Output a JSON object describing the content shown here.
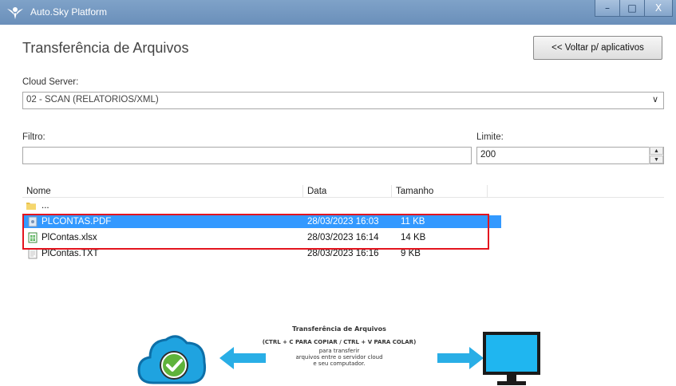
{
  "window": {
    "title": "Auto.Sky Platform",
    "minimize": "–",
    "maximize": "□",
    "close": "X"
  },
  "header": {
    "title": "Transferência de Arquivos",
    "back_button": "<< Voltar p/ aplicativos"
  },
  "cloud_server": {
    "label": "Cloud Server:",
    "selected": "02 - SCAN (RELATORIOS/XML)"
  },
  "filter": {
    "label": "Filtro:",
    "value": ""
  },
  "limit": {
    "label": "Limite:",
    "value": "200"
  },
  "file_list": {
    "columns": [
      "Nome",
      "Data",
      "Tamanho"
    ],
    "parent_dir": "...",
    "rows": [
      {
        "name": "PLCONTAS.PDF",
        "date": "28/03/2023 16:03",
        "size": "11 KB",
        "icon": "pdf-file-icon",
        "selected": true
      },
      {
        "name": "PlContas.xlsx",
        "date": "28/03/2023 16:14",
        "size": "14 KB",
        "icon": "excel-file-icon",
        "selected": false
      },
      {
        "name": "PlContas.TXT",
        "date": "28/03/2023 16:16",
        "size": "9 KB",
        "icon": "text-file-icon",
        "selected": false
      }
    ]
  },
  "banner": {
    "title": "Transferência de Arquivos",
    "shortcut": "(CTRL + C PARA COPIAR / CTRL + V PARA COLAR)",
    "line1": "para transferir",
    "line2": "arquivos entre o servidor cloud",
    "line3": "e seu computador."
  },
  "colors": {
    "titlebar": "#6f93be",
    "selection": "#3399ff",
    "highlight_border": "#e4141e",
    "banner_blue": "#1fa3e0"
  }
}
